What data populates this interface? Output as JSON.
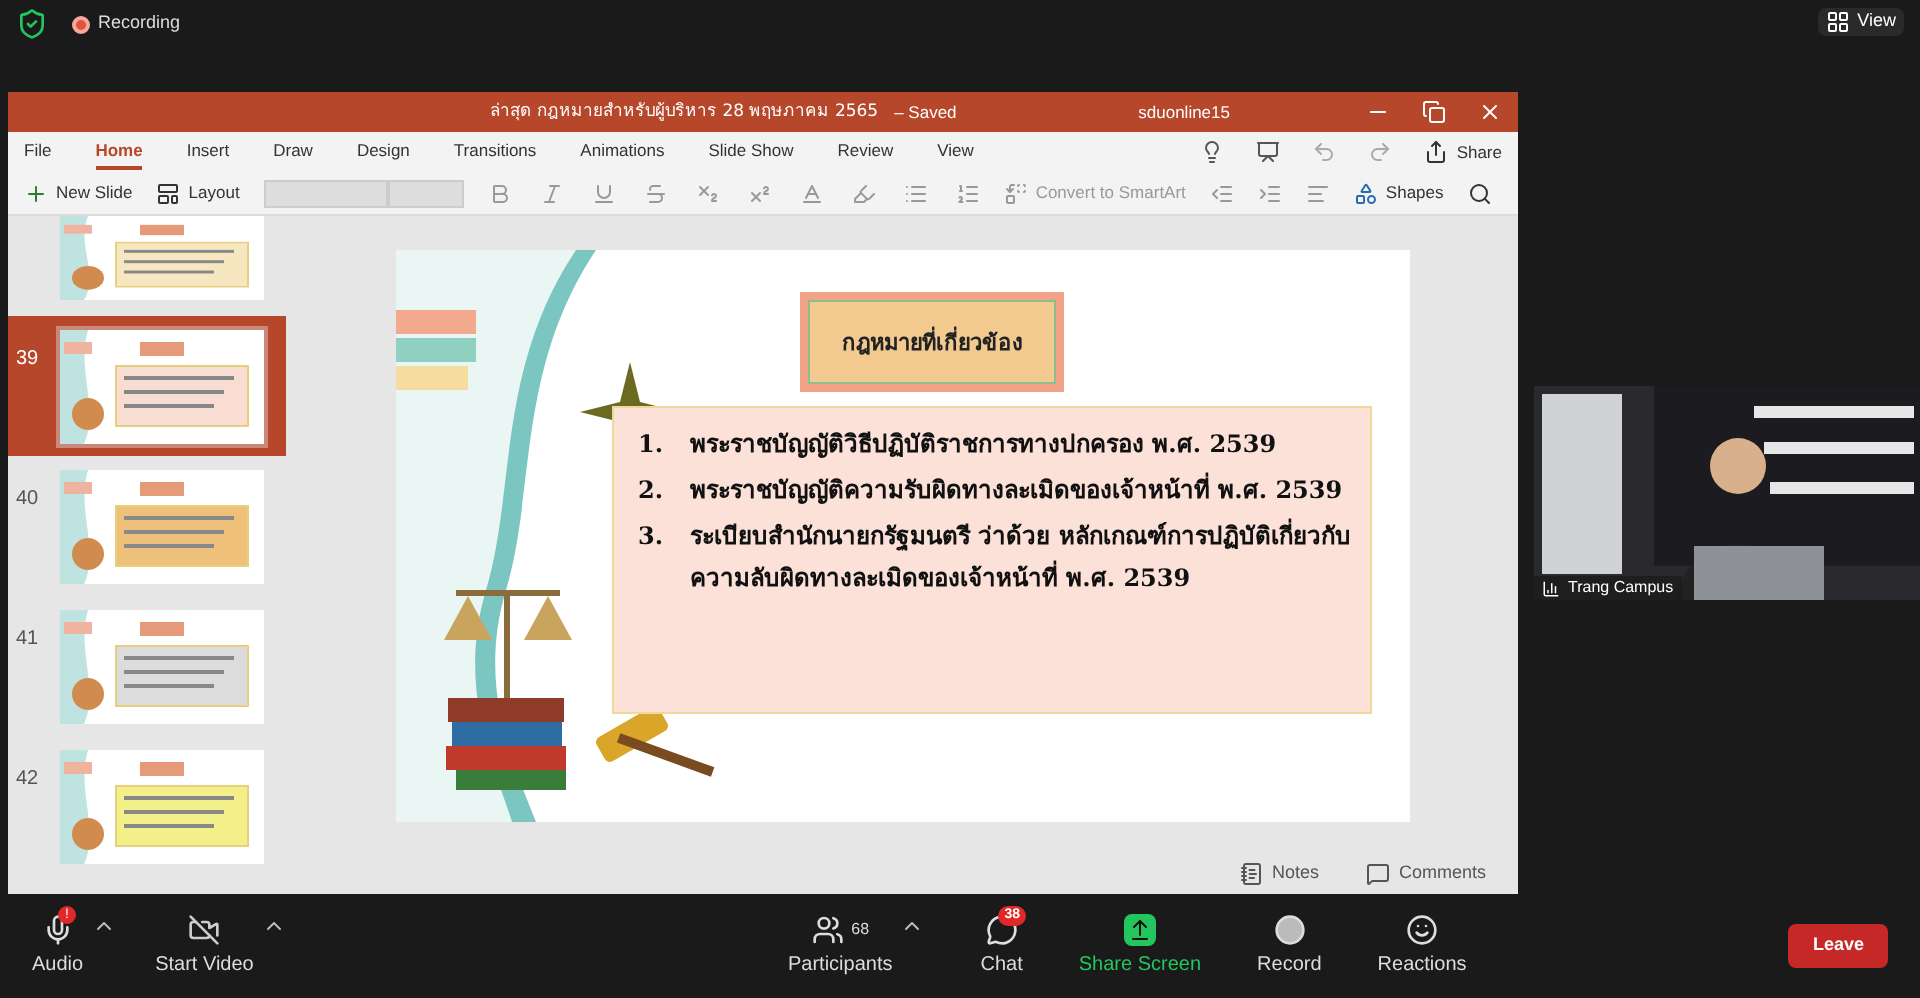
{
  "top_bar": {
    "recording_label": "Recording",
    "view_button": "View"
  },
  "ppt": {
    "title": "ล่าสุด กฎหมายสำหรับผู้บริหาร 28 พฤษภาคม 2565",
    "save_status": "– Saved",
    "user": "sduonline15",
    "menu": [
      {
        "label": "File",
        "selected": false
      },
      {
        "label": "Home",
        "selected": true
      },
      {
        "label": "Insert",
        "selected": false
      },
      {
        "label": "Draw",
        "selected": false
      },
      {
        "label": "Design",
        "selected": false
      },
      {
        "label": "Transitions",
        "selected": false
      },
      {
        "label": "Animations",
        "selected": false
      },
      {
        "label": "Slide Show",
        "selected": false
      },
      {
        "label": "Review",
        "selected": false
      },
      {
        "label": "View",
        "selected": false
      }
    ],
    "share": "Share",
    "toolbar": {
      "new_slide": "New Slide",
      "layout": "Layout",
      "convert": "Convert to SmartArt",
      "shapes": "Shapes"
    },
    "thumbnails": [
      {
        "kind": "cut",
        "selected": false,
        "color": "#f6e7c1"
      },
      {
        "kind": "full",
        "number": "39",
        "selected": true,
        "color": "#f9dcd2"
      },
      {
        "kind": "full",
        "number": "40",
        "selected": false,
        "color": "#efc07a"
      },
      {
        "kind": "full",
        "number": "41",
        "selected": false,
        "color": "#dcdcdc"
      },
      {
        "kind": "full",
        "number": "42",
        "selected": false,
        "color": "#f3f08a"
      }
    ],
    "slide": {
      "heading": "กฎหมายที่เกี่ยวข้อง",
      "items": [
        {
          "number": "1.",
          "text": "พระราชบัญญัติวิธีปฏิบัติราชการทางปกครอง พ.ศ. 2539"
        },
        {
          "number": "2.",
          "text": "พระราชบัญญัติความรับผิดทางละเมิดของเจ้าหน้าที่ พ.ศ. 2539"
        },
        {
          "number": "3.",
          "text": "ระเบียบสำนักนายกรัฐมนตรี ว่าด้วย หลักเกณฑ์การปฏิบัติเกี่ยวกับความลับผิดทางละเมิดของเจ้าหน้าที่ พ.ศ. 2539"
        }
      ]
    },
    "status": {
      "notes": "Notes",
      "comments": "Comments"
    }
  },
  "video": {
    "name": "Trang Campus"
  },
  "controls": {
    "audio": "Audio",
    "audio_alert": "!",
    "start_video": "Start Video",
    "participant_count": "68",
    "participants": "Participants",
    "chat_badge": "38",
    "chat": "Chat",
    "share": "Share Screen",
    "record": "Record",
    "reactions": "Reactions",
    "leave": "Leave"
  }
}
